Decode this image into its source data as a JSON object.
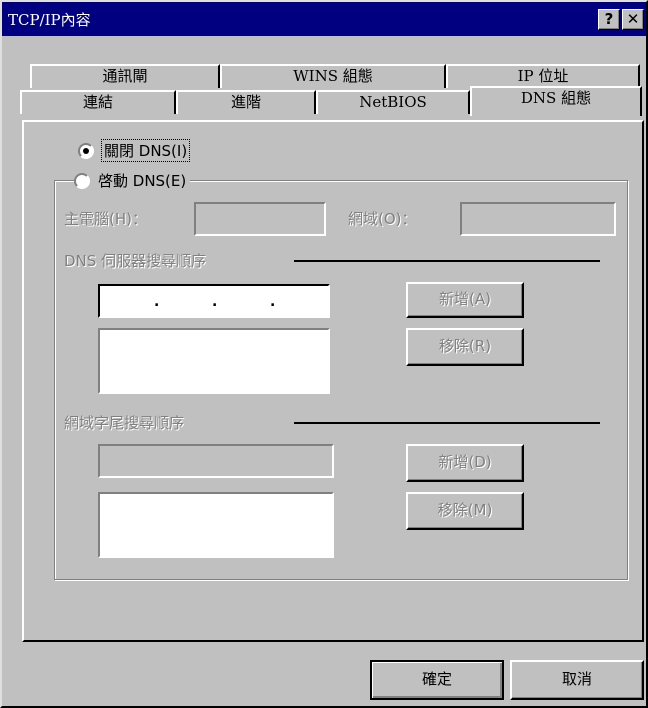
{
  "window": {
    "title": "TCP/IP內容",
    "help_label": "?",
    "close_label": "✕"
  },
  "tabs_back": [
    "通訊閘",
    "WINS 組態",
    "IP 位址"
  ],
  "tabs_front": [
    "連結",
    "進階",
    "NetBIOS",
    "DNS 組態"
  ],
  "dns": {
    "disable_label": "關閉 DNS(I)",
    "enable_label": "啓動 DNS(E)",
    "selected": "disable",
    "host_label": "主電腦(H)：",
    "host_value": "",
    "domain_label": "網域(O)：",
    "domain_value": "",
    "server_order_label": "DNS 伺服器搜尋順序",
    "ip_value": "",
    "add_server_label": "新增(A)",
    "remove_server_label": "移除(R)",
    "suffix_order_label": "網域字尾搜尋順序",
    "suffix_value": "",
    "add_suffix_label": "新增(D)",
    "remove_suffix_label": "移除(M)"
  },
  "footer": {
    "ok_label": "確定",
    "cancel_label": "取消"
  }
}
